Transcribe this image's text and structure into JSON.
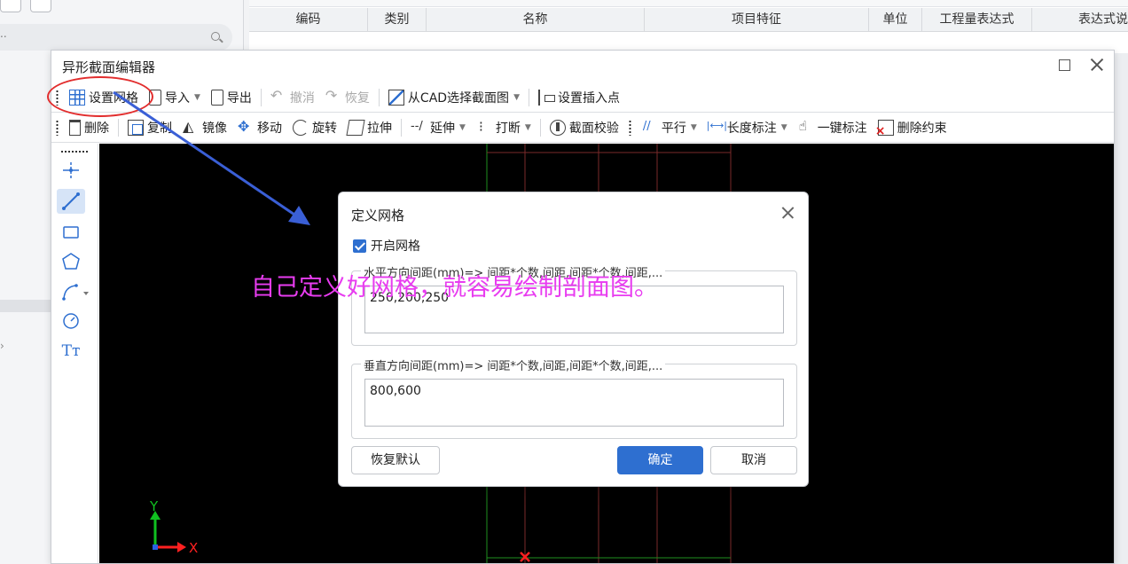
{
  "background_table": {
    "headers": [
      "编码",
      "类别",
      "名称",
      "项目特征",
      "单位",
      "工程量表达式",
      "表达式说"
    ]
  },
  "editor": {
    "title": "异形截面编辑器",
    "toolbar1": [
      {
        "label": "设置网格",
        "icon": "grid-icon"
      },
      {
        "label": "导入",
        "icon": "import-icon",
        "dropdown": true
      },
      {
        "label": "导出",
        "icon": "export-icon"
      },
      {
        "label": "撤消",
        "icon": "undo-icon",
        "disabled": true
      },
      {
        "label": "恢复",
        "icon": "redo-icon",
        "disabled": true
      },
      {
        "label": "从CAD选择截面图",
        "icon": "cad-select-icon",
        "dropdown": true
      },
      {
        "label": "设置插入点",
        "icon": "insert-point-icon"
      }
    ],
    "toolbar2": [
      {
        "label": "删除",
        "icon": "delete-icon"
      },
      {
        "label": "复制",
        "icon": "copy-icon"
      },
      {
        "label": "镜像",
        "icon": "mirror-icon"
      },
      {
        "label": "移动",
        "icon": "move-icon"
      },
      {
        "label": "旋转",
        "icon": "rotate-icon"
      },
      {
        "label": "拉伸",
        "icon": "stretch-icon"
      },
      {
        "label": "延伸",
        "icon": "extend-icon",
        "dropdown": true
      },
      {
        "label": "打断",
        "icon": "break-icon",
        "dropdown": true
      },
      {
        "label": "截面校验",
        "icon": "section-check-icon"
      },
      {
        "label": "平行",
        "icon": "parallel-icon",
        "dropdown": true
      },
      {
        "label": "长度标注",
        "icon": "length-dimension-icon",
        "dropdown": true
      },
      {
        "label": "一键标注",
        "icon": "one-key-dimension-icon"
      },
      {
        "label": "删除约束",
        "icon": "delete-constraint-icon"
      }
    ],
    "palette": [
      "point-icon",
      "line-icon",
      "rectangle-icon",
      "polygon-icon",
      "arc-icon",
      "circle-icon",
      "text-icon"
    ],
    "palette_text_glyph": "Tт",
    "axis": {
      "x": "X",
      "y": "Y"
    }
  },
  "dialog": {
    "title": "定义网格",
    "enable_grid_label": "开启网格",
    "enable_grid_checked": true,
    "horizontal_legend": "水平方向间距(mm)=> 间距*个数,间距,间距*个数,间距,...",
    "horizontal_value": "250,200,250",
    "vertical_legend": "垂直方向间距(mm)=> 间距*个数,间距,间距*个数,间距,...",
    "vertical_value": "800,600",
    "restore_default_label": "恢复默认",
    "ok_label": "确定",
    "cancel_label": "取消"
  },
  "annotation": {
    "text": "自己定义好网格，就容易绘制剖面图。",
    "color": "#e83cf0",
    "highlight_color": "#e22d2d",
    "arrow_color": "#3a5fd6"
  },
  "colors": {
    "accent": "#2e6fd0",
    "canvas_bg": "#000000",
    "grid_line_red": "#7a2a2a",
    "grid_line_green": "#1f8f1f"
  }
}
